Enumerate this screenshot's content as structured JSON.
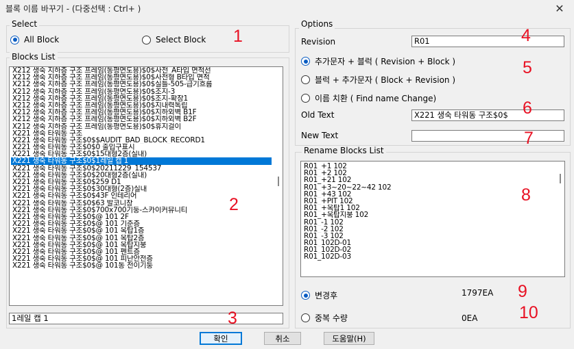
{
  "window": {
    "title": "블록 이름 바꾸기 - (다중선택 : Ctrl+ )",
    "close_glyph": "✕"
  },
  "select_group": {
    "label": "Select",
    "all_block": "All Block",
    "select_block": "Select Block",
    "selected": "all_block"
  },
  "blocks_list": {
    "label": "Blocks List",
    "items": [
      "X212 생숙 지하층 구조 프레임(동평면도용)$0$사전_A타입 면적선",
      "X212 생숙 지하층 구조 프레임(동평면도용)$0$사전형 B타입 면적",
      "X212 생숙 지하층 구조 프레임(동평면도용)$0$실틀-505-급기흐름",
      "X212 생숙 지하층 구조 프레임(동평면도용)$0$조지-3",
      "X212 생숙 지하층 구조 프레임(동평면도용)$0$조지-확장1",
      "X212 생숙 지하층 구조 프레임(동평면도용)$0$지내력독립",
      "X212 생숙 지하층 구조 프레임(동평면도용)$0$지하외벽 B1F",
      "X212 생숙 지하층 구조 프레임(동평면도용)$0$지하외벽 B2F",
      "X212 생숙 지하층 구조 프레임(동평면도용)$0$휴지걸이",
      "X221 생숙 타워동 구조",
      "X221 생숙 타워동 구조$0$$AUDIT_BAD_BLOCK_RECORD1",
      "X221 생숙 타워동 구조$0$0 출입구표시",
      "X221 생숙 타워동 구조$0$15대형2층(실내)",
      "X221 생숙 타워동 구조$0$1레일 캡 1",
      "X221 생숙 타워동 구조$0$20211229_154537",
      "X221 생숙 타워동 구조$0$20대형2층(실내)",
      "X221 생숙 타워동 구조$0$259 D1",
      "X221 생숙 타워동 구조$0$30대형(2층)실내",
      "X221 생숙 타워동 구조$0$43F 인테리어",
      "X221 생숙 타워동 구조$0$63 발코니창",
      "X221 생숙 타워동 구조$0$700x700기둥-스카이커뮤니티",
      "X221 생숙 타워동 구조$0$@ 101 2F",
      "X221 생숙 타워동 구조$0$@ 101 기준층",
      "X221 생숙 타워동 구조$0$@ 101 옥탑1층",
      "X221 생숙 타워동 구조$0$@ 101 옥탑2층",
      "X221 생숙 타워동 구조$0$@ 101 옥탑지붕",
      "X221 생숙 타워동 구조$0$@ 101 펜트층",
      "X221 생숙 타워동 구조$0$@ 101 피난안전층",
      "X221 생숙 타워동 구조$0$@ 101동 전이기둥"
    ],
    "selected_index": 13
  },
  "name_field": {
    "value": "1레일 캡 1"
  },
  "options": {
    "label": "Options",
    "revision_label": "Revision",
    "revision_value": "R01",
    "radio_prefix": "추가문자 + 블럭 ( Revision + Block )",
    "radio_suffix": "블럭 + 추가문자 ( Block + Revision )",
    "radio_replace": "이름 치환 ( Find name Change)",
    "selected": "prefix",
    "old_text_label": "Old Text",
    "old_text_value": "X221 생숙 타워동 구조$0$",
    "new_text_label": "New Text",
    "new_text_value": ""
  },
  "rename_list": {
    "label": "Rename Blocks List",
    "items": [
      "R01_+1 102",
      "R01_+2 102",
      "R01_+21 102",
      "R01_+3~20~22~42 102",
      "R01_+43 102",
      "R01_+PIT 102",
      "R01_+옥탑1 102",
      "R01_+옥탑지붕 102",
      "R01_-1 102",
      "R01_-2 102",
      "R01_-3 102",
      "R01_102D-01",
      "R01_102D-02",
      "R01_102D-03"
    ]
  },
  "stats": {
    "after_label": "변경후",
    "after_count": "1797EA",
    "dup_label": "중복 수량",
    "dup_count": "0EA",
    "selected": "after"
  },
  "buttons": {
    "ok": "확인",
    "cancel": "취소",
    "help": "도움말(H)"
  },
  "annotations": [
    "1",
    "2",
    "3",
    "4",
    "5",
    "6",
    "7",
    "8",
    "9",
    "10"
  ],
  "colors": {
    "selection": "#0078d7",
    "annotation": "#e81123",
    "radio_accent": "#0a5cc2"
  }
}
